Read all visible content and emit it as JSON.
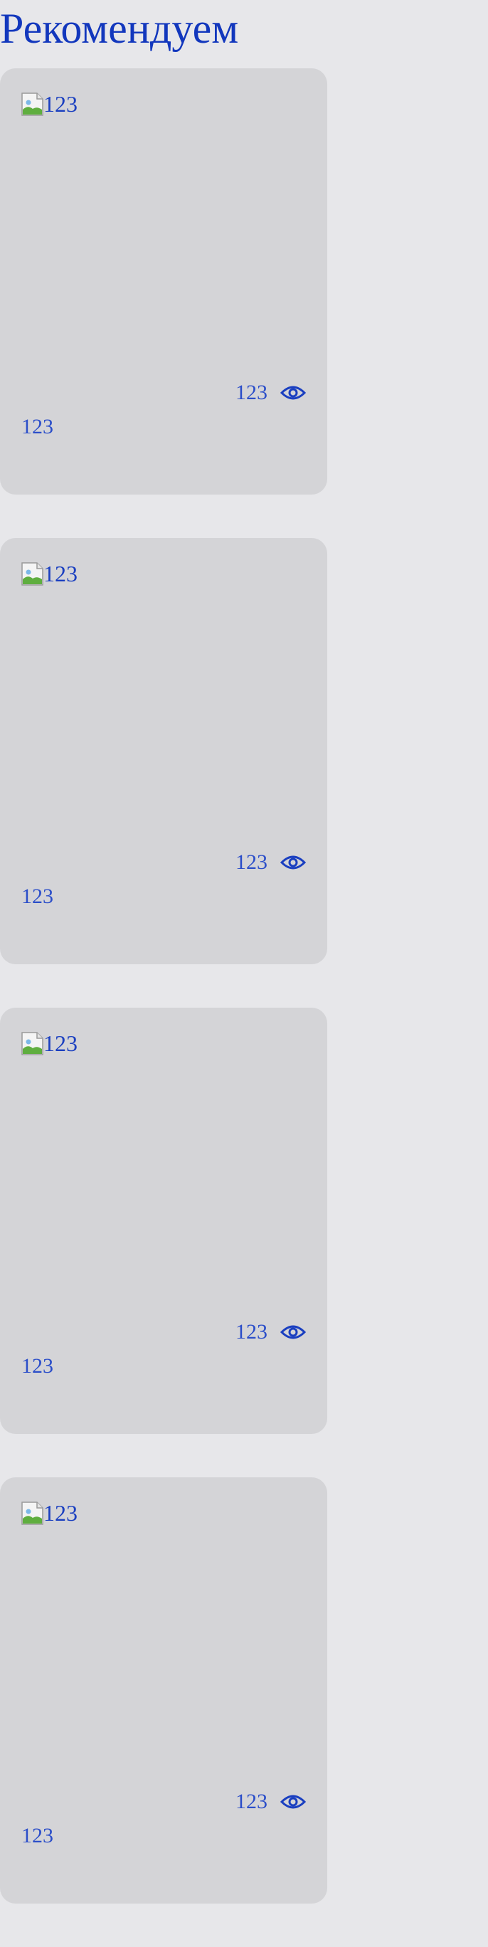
{
  "page": {
    "title": "Рекомендуем"
  },
  "cards": [
    {
      "image_alt": "123",
      "views": "123",
      "title": "123"
    },
    {
      "image_alt": "123",
      "views": "123",
      "title": "123"
    },
    {
      "image_alt": "123",
      "views": "123",
      "title": "123"
    },
    {
      "image_alt": "123",
      "views": "123",
      "title": "123"
    }
  ],
  "icons": {
    "image": "broken-image-icon",
    "views": "eye-icon"
  },
  "colors": {
    "background": "#e7e7ea",
    "card": "#d4d4d7",
    "text": "#1a3fc0"
  }
}
